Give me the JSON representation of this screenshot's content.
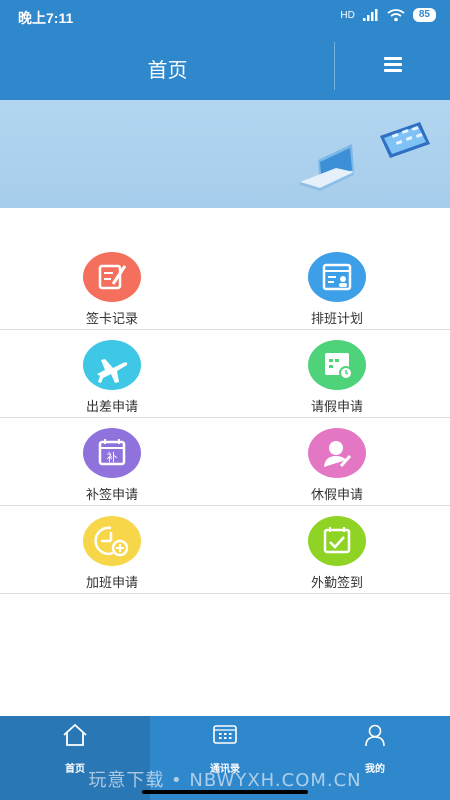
{
  "status_bar": {
    "time": "晚上7:11",
    "network": "HD",
    "battery": "85"
  },
  "header": {
    "title": "首页"
  },
  "grid": {
    "items": [
      {
        "label": "签卡记录",
        "icon": "edit-doc-icon",
        "color": "#f4705c"
      },
      {
        "label": "排班计划",
        "icon": "schedule-person-icon",
        "color": "#3d9fe8"
      },
      {
        "label": "出差申请",
        "icon": "airplane-icon",
        "color": "#3fc7e6"
      },
      {
        "label": "请假申请",
        "icon": "calendar-clock-icon",
        "color": "#4fd37a"
      },
      {
        "label": "补签申请",
        "icon": "calendar-supplement-icon",
        "color": "#8f72db"
      },
      {
        "label": "休假申请",
        "icon": "person-edit-icon",
        "color": "#e477c4"
      },
      {
        "label": "加班申请",
        "icon": "clock-plus-icon",
        "color": "#f7d64a"
      },
      {
        "label": "外勤签到",
        "icon": "calendar-check-icon",
        "color": "#8fd324"
      }
    ]
  },
  "tabbar": {
    "tabs": [
      {
        "label": "首页",
        "icon": "home-icon",
        "active": true
      },
      {
        "label": "通讯录",
        "icon": "keypad-icon",
        "active": false
      },
      {
        "label": "我的",
        "icon": "user-icon",
        "active": false
      }
    ]
  },
  "watermark": "玩意下载 • NBWYXH.COM.CN",
  "colors": {
    "primary": "#2f87cc",
    "active_tab": "#2a77b6",
    "banner": "#b3d6f0"
  }
}
